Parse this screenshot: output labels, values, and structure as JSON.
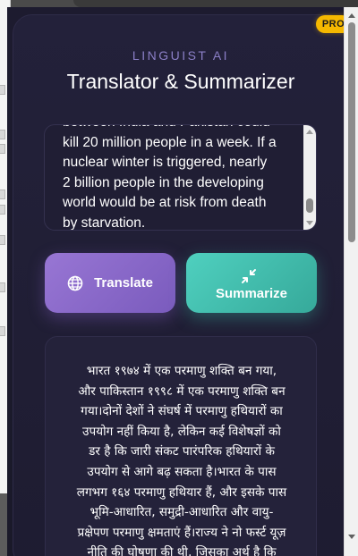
{
  "badge": {
    "label": "PRO",
    "color": "#f5b800"
  },
  "header": {
    "brand": "LINGUIST AI",
    "title": "Translator & Summarizer"
  },
  "input": {
    "lines": [
      "between India and Pakistan could",
      "kill 20 million people in a week. If a",
      "nuclear winter is triggered, nearly",
      "2 billion people in the developing",
      "world would be at risk from death",
      "by starvation."
    ]
  },
  "actions": {
    "translate_label": "Translate",
    "translate_icon": "globe-icon",
    "summarize_label": "Summarize",
    "summarize_icon": "compress-arrows-icon"
  },
  "output": {
    "lines": [
      "भारत १९७४ में एक परमाणु शक्ति बन गया,",
      "और पाकिस्तान १९९८ में एक परमाणु शक्ति बन",
      "गया।दोनों देशों ने संघर्ष में परमाणु हथियारों का",
      "उपयोग नहीं किया है, लेकिन कई विशेषज्ञों को",
      "डर है कि जारी संकट पारंपरिक हथियारों के",
      "उपयोग से आगे बढ़ सकता है।भारत के पास",
      "लगभग १६४ परमाणु हथियार हैं, और इसके पास",
      "भूमि-आधारित, समुद्री-आधारित और वायु-",
      "प्रक्षेपण परमाणु क्षमताएं हैं।राज्य ने नो फर्स्ट यूज़",
      "नीति की घोषणा की थी, जिसका अर्थ है कि"
    ]
  },
  "colors": {
    "accent_purple": "#8b6cc9",
    "accent_teal": "#43c0ae",
    "background": "#1d1b2f"
  }
}
